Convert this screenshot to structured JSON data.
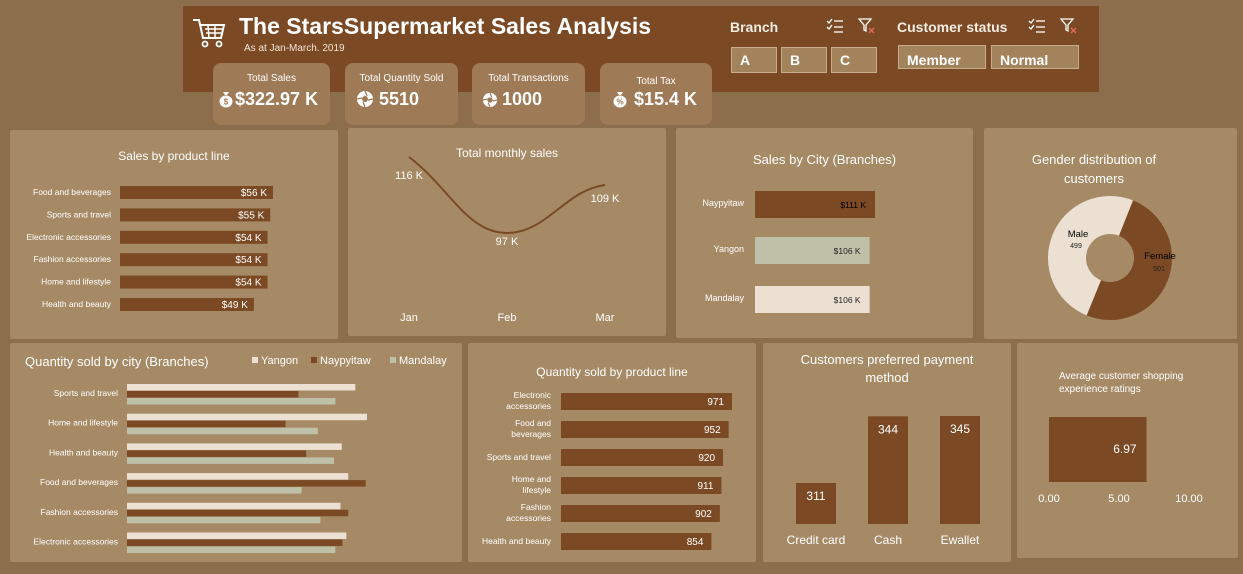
{
  "header": {
    "title": "The StarsSupermarket Sales Analysis",
    "subtitle": "As at Jan-March. 2019",
    "branch_label": "Branch",
    "branches": [
      "A",
      "B",
      "C"
    ],
    "customer_status_label": "Customer status",
    "customer_status": [
      "Member",
      "Normal"
    ]
  },
  "kpis": [
    {
      "label": "Total Sales",
      "value": "$322.97 K",
      "icon": "money-bag-icon"
    },
    {
      "label": "Total Quantity Sold",
      "value": "5510",
      "icon": "aperture-icon"
    },
    {
      "label": "Total Transactions",
      "value": "1000",
      "icon": "aperture-icon"
    },
    {
      "label": "Total Tax",
      "value": "$15.4 K",
      "icon": "money-bag-icon"
    }
  ],
  "colors": {
    "background": "#8c6d4c",
    "panel": "#a68a66",
    "header": "#7b4a25",
    "bar_brown": "#7b4a25",
    "yangon": "#ece0d3",
    "naypyitaw": "#7b4a25",
    "mandalay": "#bec0a8"
  },
  "chart_data": [
    {
      "id": "sales_by_product_line",
      "type": "bar",
      "title": "Sales by product line",
      "categories": [
        "Food and beverages",
        "Sports and travel",
        "Electronic accessories",
        "Fashion accessories",
        "Home and lifestyle",
        "Health and beauty"
      ],
      "values": [
        56,
        55,
        54,
        54,
        54,
        49
      ],
      "labels": [
        "$56 K",
        "$55 K",
        "$54 K",
        "$54 K",
        "$54 K",
        "$49 K"
      ]
    },
    {
      "id": "total_monthly_sales",
      "type": "line",
      "title": "Total monthly sales",
      "categories": [
        "Jan",
        "Feb",
        "Mar"
      ],
      "values": [
        116,
        97,
        109
      ],
      "labels": [
        "116 K",
        "97 K",
        "109 K"
      ]
    },
    {
      "id": "sales_by_city",
      "type": "bar",
      "title": "Sales by City (Branches)",
      "categories": [
        "Naypyitaw",
        "Yangon",
        "Mandalay"
      ],
      "values": [
        111,
        106,
        106
      ],
      "labels": [
        "$111 K",
        "$106 K",
        "$106 K"
      ],
      "colors": [
        "#7b4a25",
        "#bec0a8",
        "#ece0d3"
      ]
    },
    {
      "id": "gender_distribution",
      "type": "pie",
      "title": "Gender distribution of customers",
      "categories": [
        "Male",
        "Female"
      ],
      "values": [
        499,
        501
      ],
      "colors": [
        "#ece0d3",
        "#7b4a25"
      ]
    },
    {
      "id": "quantity_by_city",
      "type": "bar",
      "title": "Quantity sold by city (Branches)",
      "categories": [
        "Sports and travel",
        "Home and lifestyle",
        "Health and beauty",
        "Food and beverages",
        "Fashion accessories",
        "Electronic accessories"
      ],
      "series": [
        {
          "name": "Yangon",
          "color": "#ece0d3",
          "values": [
            353,
            371,
            332,
            342,
            330,
            339
          ]
        },
        {
          "name": "Naypyitaw",
          "color": "#7b4a25",
          "values": [
            265,
            245,
            277,
            369,
            342,
            333
          ]
        },
        {
          "name": "Mandalay",
          "color": "#bec0a8",
          "values": [
            322,
            295,
            320,
            270,
            299,
            322
          ]
        }
      ],
      "legend": "top"
    },
    {
      "id": "quantity_by_product_line",
      "type": "bar",
      "title": "Quantity sold by product line",
      "categories": [
        "Electronic accessories",
        "Food and beverages",
        "Sports and travel",
        "Home and lifestyle",
        "Fashion accessories",
        "Health and beauty"
      ],
      "values": [
        971,
        952,
        920,
        911,
        902,
        854
      ]
    },
    {
      "id": "payment_method",
      "type": "bar",
      "title": "Customers preferred payment method",
      "categories": [
        "Credit card",
        "Cash",
        "Ewallet"
      ],
      "values": [
        311,
        344,
        345
      ]
    },
    {
      "id": "avg_rating",
      "type": "bar",
      "title": "Average customer shopping experience ratings",
      "value": 6.97,
      "value_label": "6.97",
      "ticks": [
        "0.00",
        "5.00",
        "10.00"
      ],
      "xlim": [
        0,
        10
      ]
    }
  ]
}
